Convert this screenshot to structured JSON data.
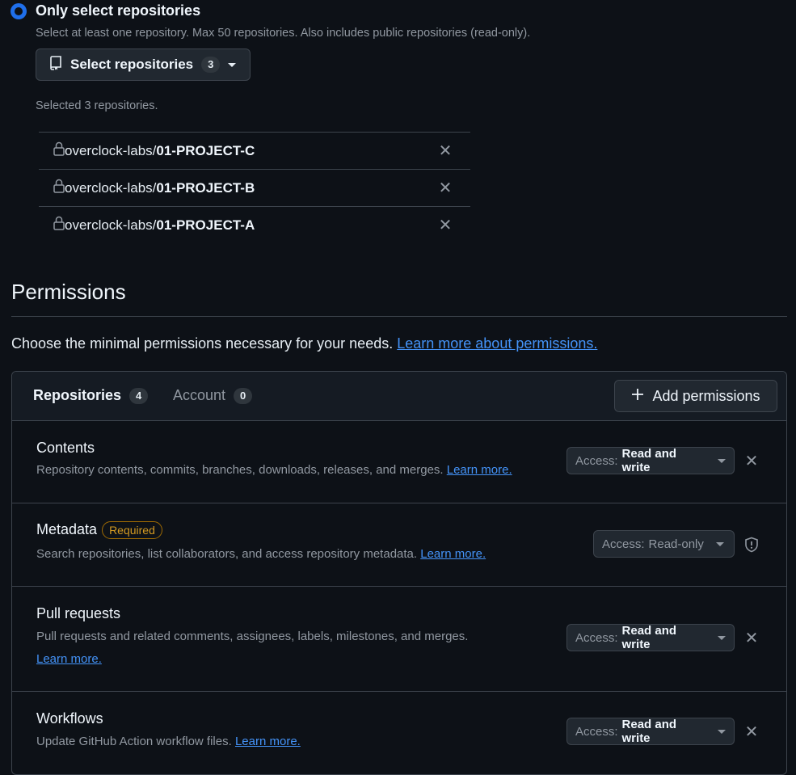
{
  "repo_selection": {
    "option_label": "Only select repositories",
    "option_description": "Select at least one repository. Max 50 repositories. Also includes public repositories (read-only).",
    "select_button_label": "Select repositories",
    "select_button_count": "3",
    "selected_summary": "Selected 3 repositories.",
    "repositories": [
      {
        "owner": "overclock-labs/",
        "name": "01-PROJECT-C"
      },
      {
        "owner": "overclock-labs/",
        "name": "01-PROJECT-B"
      },
      {
        "owner": "overclock-labs/",
        "name": "01-PROJECT-A"
      }
    ]
  },
  "permissions": {
    "title": "Permissions",
    "intro": "Choose the minimal permissions necessary for your needs.",
    "intro_link": "Learn more about permissions.",
    "tabs": [
      {
        "label": "Repositories",
        "count": "4"
      },
      {
        "label": "Account",
        "count": "0"
      }
    ],
    "add_button": "Add permissions",
    "items": [
      {
        "title": "Contents",
        "description": "Repository contents, commits, branches, downloads, releases, and merges.",
        "learn_more": "Learn more.",
        "access_label": "Access:",
        "access_value": "Read and write"
      },
      {
        "title": "Metadata",
        "badge": "Required",
        "description": "Search repositories, list collaborators, and access repository metadata.",
        "learn_more": "Learn more.",
        "access_label": "Access:",
        "access_value": "Read-only"
      },
      {
        "title": "Pull requests",
        "description": "Pull requests and related comments, assignees, labels, milestones, and merges.",
        "learn_more": "Learn more.",
        "access_label": "Access:",
        "access_value": "Read and write"
      },
      {
        "title": "Workflows",
        "description": "Update GitHub Action workflow files.",
        "learn_more": "Learn more.",
        "access_label": "Access:",
        "access_value": "Read and write"
      }
    ]
  }
}
